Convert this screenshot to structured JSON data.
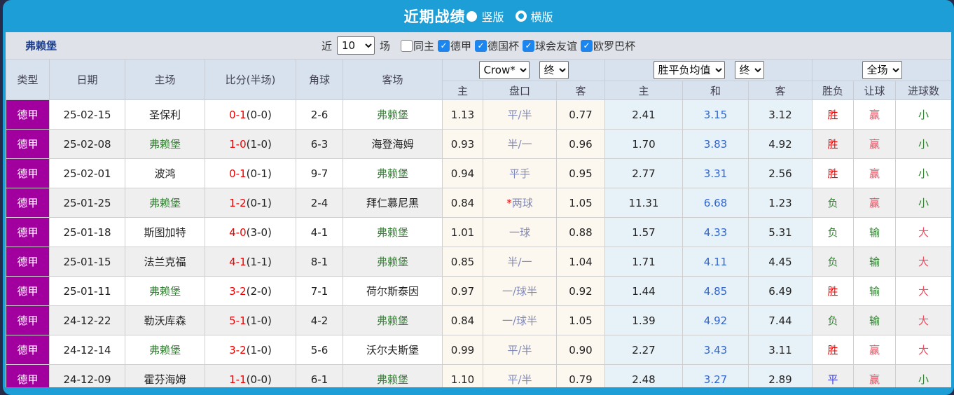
{
  "colors": {
    "accent_blue": "#1e9ed7",
    "league_badge_purple": "#a1009f",
    "win_red": "#ee0000",
    "lose_green": "#338033",
    "draw_blue": "#3c3cd9",
    "handicap_win_pink": "#f24a5e",
    "team_green": "#2e8b2e",
    "avg_draw_blue": "#3366cc",
    "checkbox_blue": "#1c86ee"
  },
  "icons": {
    "check": "✓"
  },
  "titlebar": {
    "title": "近期战绩",
    "radio_vertical_label": "竖版",
    "radio_vertical_selected": true,
    "radio_horizontal_label": "横版",
    "radio_horizontal_selected": false
  },
  "filterbar": {
    "team": "弗赖堡",
    "near_label": "近",
    "count_value": "10",
    "matches_label": "场",
    "same_home_label": "同主",
    "same_home_checked": false,
    "league_options": [
      "德甲",
      "德国杯",
      "球会友谊",
      "欧罗巴杯"
    ],
    "league_checked": [
      true,
      true,
      true,
      true
    ]
  },
  "header": {
    "type": "类型",
    "date": "日期",
    "home": "主场",
    "score": "比分(半场)",
    "corners": "角球",
    "away": "客场",
    "bookmaker": "Crow*",
    "bookmaker_state": "终",
    "odds_home": "主",
    "odds_handicap": "盘口",
    "odds_away": "客",
    "avg": "胜平负均值",
    "avg_state": "终",
    "avg_home": "主",
    "avg_draw": "和",
    "avg_away": "客",
    "scope": "全场",
    "result": "胜负",
    "handicap_result": "让球",
    "goals": "进球数"
  },
  "rows": [
    {
      "league": "德甲",
      "date": "25-02-15",
      "home": "圣保利",
      "score": "0-1",
      "half": "(0-0)",
      "corners": "2-6",
      "away": "弗赖堡",
      "odds_home": "1.13",
      "handicap_prefix": "",
      "handicap": "平/半",
      "odds_away": "0.77",
      "avg_home": "2.41",
      "avg_draw": "3.15",
      "avg_away": "3.12",
      "result": "胜",
      "handicap_result": "赢",
      "goals": "小"
    },
    {
      "league": "德甲",
      "date": "25-02-08",
      "home": "弗赖堡",
      "score": "1-0",
      "half": "(1-0)",
      "corners": "6-3",
      "away": "海登海姆",
      "odds_home": "0.93",
      "handicap_prefix": "",
      "handicap": "半/一",
      "odds_away": "0.96",
      "avg_home": "1.70",
      "avg_draw": "3.83",
      "avg_away": "4.92",
      "result": "胜",
      "handicap_result": "赢",
      "goals": "小"
    },
    {
      "league": "德甲",
      "date": "25-02-01",
      "home": "波鸿",
      "score": "0-1",
      "half": "(0-1)",
      "corners": "9-7",
      "away": "弗赖堡",
      "odds_home": "0.94",
      "handicap_prefix": "",
      "handicap": "平手",
      "odds_away": "0.95",
      "avg_home": "2.77",
      "avg_draw": "3.31",
      "avg_away": "2.56",
      "result": "胜",
      "handicap_result": "赢",
      "goals": "小"
    },
    {
      "league": "德甲",
      "date": "25-01-25",
      "home": "弗赖堡",
      "score": "1-2",
      "half": "(0-1)",
      "corners": "2-4",
      "away": "拜仁慕尼黑",
      "odds_home": "0.84",
      "handicap_prefix": "*",
      "handicap": "两球",
      "odds_away": "1.05",
      "avg_home": "11.31",
      "avg_draw": "6.68",
      "avg_away": "1.23",
      "result": "负",
      "handicap_result": "赢",
      "goals": "小"
    },
    {
      "league": "德甲",
      "date": "25-01-18",
      "home": "斯图加特",
      "score": "4-0",
      "half": "(3-0)",
      "corners": "4-1",
      "away": "弗赖堡",
      "odds_home": "1.01",
      "handicap_prefix": "",
      "handicap": "一球",
      "odds_away": "0.88",
      "avg_home": "1.57",
      "avg_draw": "4.33",
      "avg_away": "5.31",
      "result": "负",
      "handicap_result": "输",
      "goals": "大"
    },
    {
      "league": "德甲",
      "date": "25-01-15",
      "home": "法兰克福",
      "score": "4-1",
      "half": "(1-1)",
      "corners": "8-1",
      "away": "弗赖堡",
      "odds_home": "0.85",
      "handicap_prefix": "",
      "handicap": "半/一",
      "odds_away": "1.04",
      "avg_home": "1.71",
      "avg_draw": "4.11",
      "avg_away": "4.45",
      "result": "负",
      "handicap_result": "输",
      "goals": "大"
    },
    {
      "league": "德甲",
      "date": "25-01-11",
      "home": "弗赖堡",
      "score": "3-2",
      "half": "(2-0)",
      "corners": "7-1",
      "away": "荷尔斯泰因",
      "odds_home": "0.97",
      "handicap_prefix": "",
      "handicap": "一/球半",
      "odds_away": "0.92",
      "avg_home": "1.44",
      "avg_draw": "4.85",
      "avg_away": "6.49",
      "result": "胜",
      "handicap_result": "输",
      "goals": "大"
    },
    {
      "league": "德甲",
      "date": "24-12-22",
      "home": "勒沃库森",
      "score": "5-1",
      "half": "(1-0)",
      "corners": "4-2",
      "away": "弗赖堡",
      "odds_home": "0.84",
      "handicap_prefix": "",
      "handicap": "一/球半",
      "odds_away": "1.05",
      "avg_home": "1.39",
      "avg_draw": "4.92",
      "avg_away": "7.44",
      "result": "负",
      "handicap_result": "输",
      "goals": "大"
    },
    {
      "league": "德甲",
      "date": "24-12-14",
      "home": "弗赖堡",
      "score": "3-2",
      "half": "(1-0)",
      "corners": "5-6",
      "away": "沃尔夫斯堡",
      "odds_home": "0.99",
      "handicap_prefix": "",
      "handicap": "平/半",
      "odds_away": "0.90",
      "avg_home": "2.27",
      "avg_draw": "3.43",
      "avg_away": "3.11",
      "result": "胜",
      "handicap_result": "赢",
      "goals": "大"
    },
    {
      "league": "德甲",
      "date": "24-12-09",
      "home": "霍芬海姆",
      "score": "1-1",
      "half": "(0-0)",
      "corners": "6-1",
      "away": "弗赖堡",
      "odds_home": "1.10",
      "handicap_prefix": "",
      "handicap": "平/半",
      "odds_away": "0.79",
      "avg_home": "2.48",
      "avg_draw": "3.27",
      "avg_away": "2.89",
      "result": "平",
      "handicap_result": "赢",
      "goals": "小"
    }
  ]
}
